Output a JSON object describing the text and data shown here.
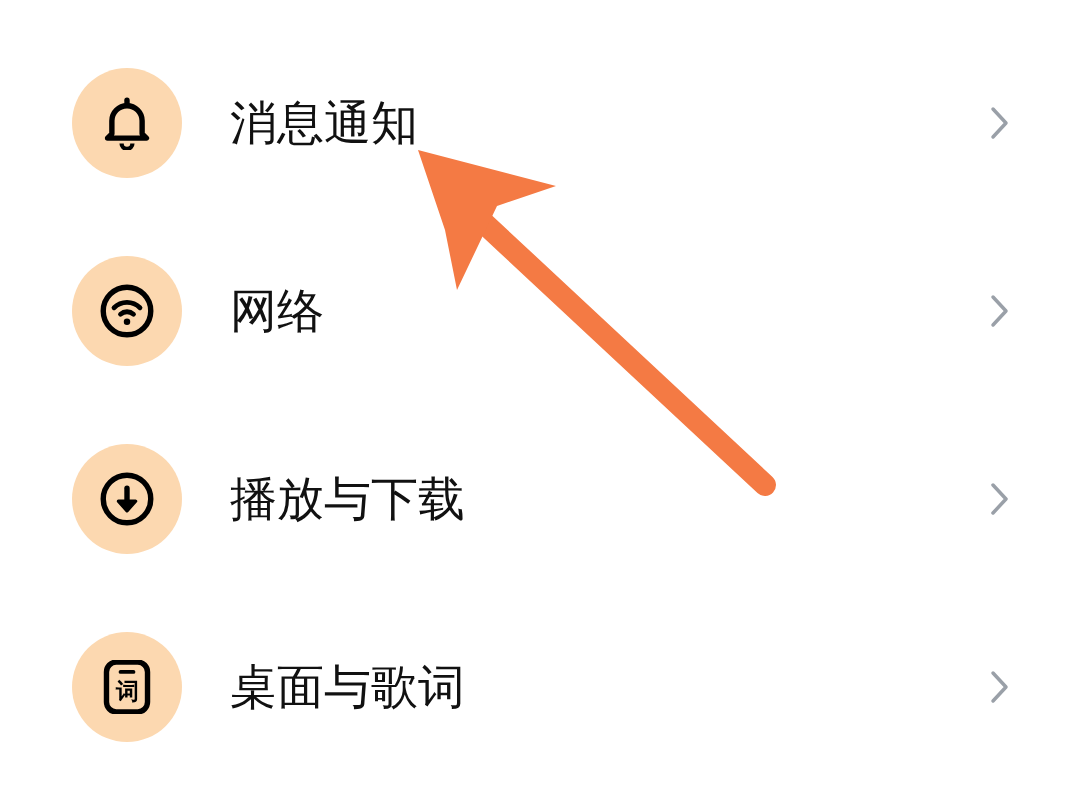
{
  "settings": [
    {
      "kind": "bell",
      "label": "消息通知"
    },
    {
      "kind": "wifi",
      "label": "网络"
    },
    {
      "kind": "download",
      "label": "播放与下载"
    },
    {
      "kind": "lyrics",
      "label": "桌面与歌词",
      "icon_glyph": "词"
    }
  ],
  "annotation": {
    "kind": "arrow"
  }
}
